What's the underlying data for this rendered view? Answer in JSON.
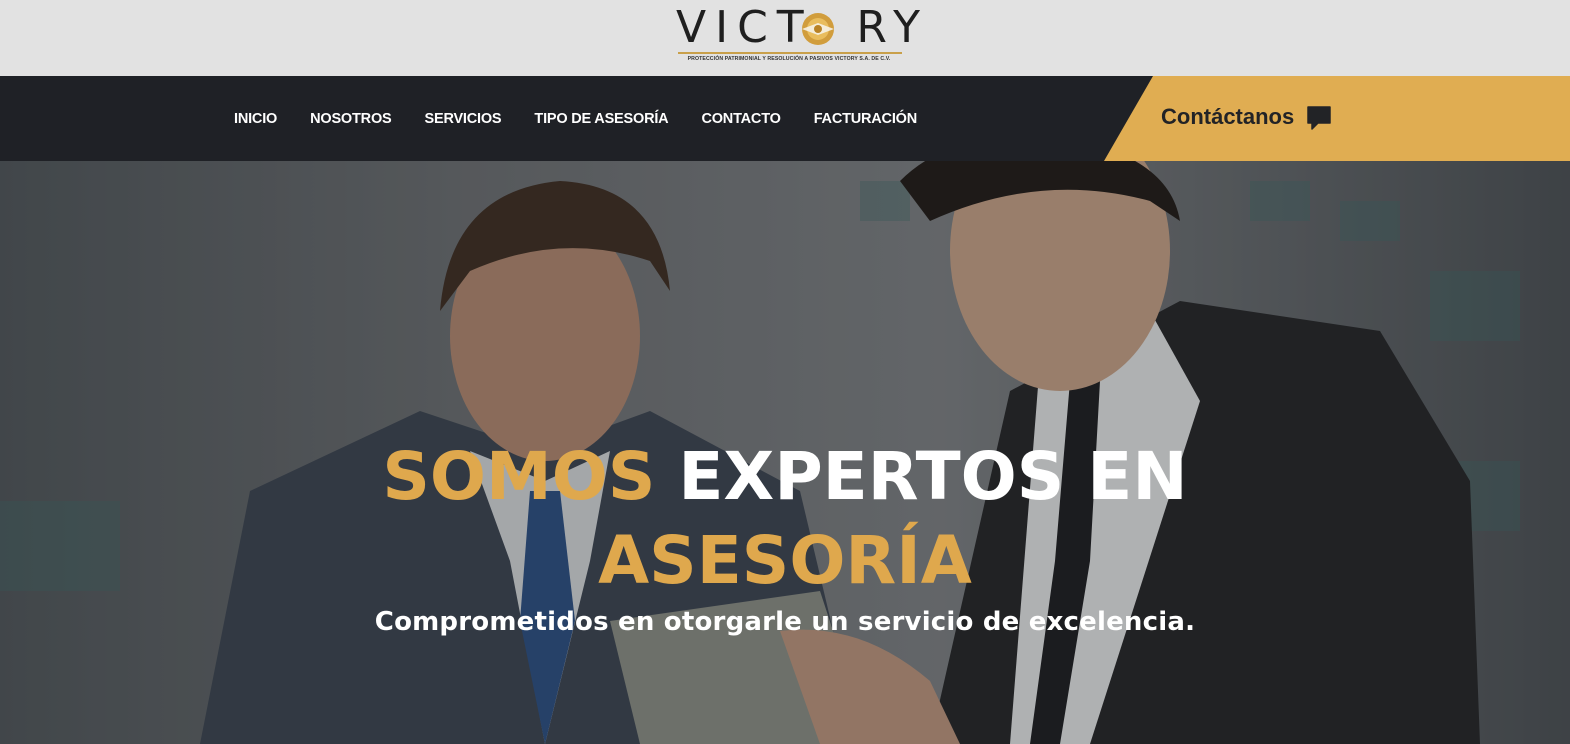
{
  "brand": {
    "name": "VICTORY",
    "subtitle": "PROTECCIÓN PATRIMONIAL Y RESOLUCIÓN A PASIVOS VICTORY S.A. DE C.V.",
    "accent_color": "#dfa84d"
  },
  "nav": {
    "items": [
      {
        "label": "INICIO"
      },
      {
        "label": "NOSOTROS"
      },
      {
        "label": "SERVICIOS"
      },
      {
        "label": "TIPO DE ASESORÍA"
      },
      {
        "label": "CONTACTO"
      },
      {
        "label": "FACTURACIÓN"
      }
    ],
    "cta_label": "Contáctanos",
    "cta_icon": "chat-bubble-icon"
  },
  "hero": {
    "headline_gold_1": "SOMOS",
    "headline_white": "EXPERTOS EN",
    "headline_gold_2": "ASESORÍA",
    "tagline": "Comprometidos en otorgarle un servicio de excelencia."
  }
}
